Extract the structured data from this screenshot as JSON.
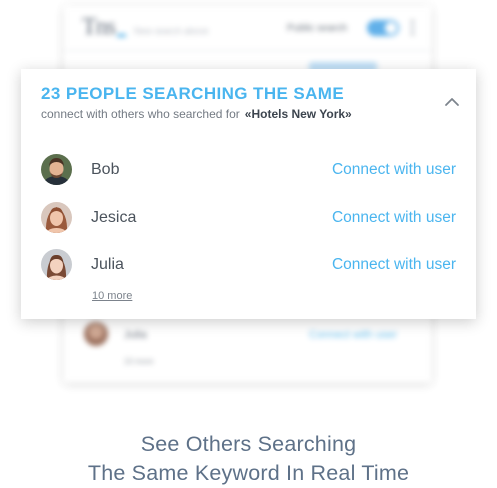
{
  "background_app": {
    "logo_text": "Tns",
    "search_placeholder": "New search above",
    "public_search_label": "Public search",
    "public_search_enabled": true,
    "faded_row": {
      "name": "Julia",
      "action": "Connect with user"
    },
    "more_label": "10 more"
  },
  "popup": {
    "title": "23 PEOPLE SEARCHING THE SAME",
    "subtitle": "connect with others who searched for",
    "keyword": "«Hotels New York»",
    "collapse_icon": "chevron-up-icon",
    "users": [
      {
        "name": "Bob",
        "action": "Connect with user",
        "avatar_icon": "avatar-man-icon"
      },
      {
        "name": "Jesica",
        "action": "Connect with user",
        "avatar_icon": "avatar-woman-icon"
      },
      {
        "name": "Julia",
        "action": "Connect with user",
        "avatar_icon": "avatar-woman-icon"
      }
    ],
    "more_label": "10 more"
  },
  "caption": {
    "line1": "See Others Searching",
    "line2": "The Same Keyword In Real Time"
  },
  "colors": {
    "accent": "#4ab5ef",
    "caption": "#5e7188",
    "text": "#4b535c"
  }
}
